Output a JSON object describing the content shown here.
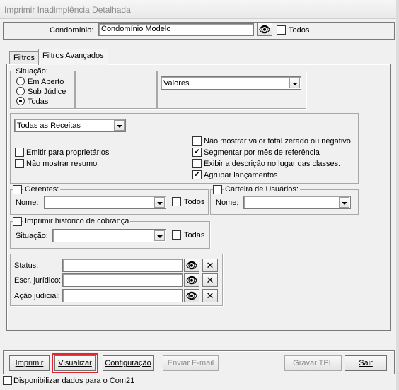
{
  "window": {
    "title": "Imprimir Inadimplência Detalhada"
  },
  "header": {
    "condominio_label": "Condomínio:",
    "condominio_value": "Condomínio Modelo",
    "todos_label": "Todos"
  },
  "tabs": [
    {
      "label": "Filtros"
    },
    {
      "label": "Filtros Avançados"
    }
  ],
  "situacao": {
    "title": "Situação:",
    "options": [
      "Em Aberto",
      "Sub Júdice",
      "Todas"
    ],
    "selected": "Todas"
  },
  "valores_select": "Valores",
  "receitas_select": "Todas as Receitas",
  "options_left": [
    {
      "label": "Emitir para proprietários",
      "checked": false
    },
    {
      "label": "Não mostrar resumo",
      "checked": false
    }
  ],
  "options_right": [
    {
      "label": "Não mostrar valor total zerado ou negativo",
      "checked": false
    },
    {
      "label": "Segmentar por mês de referência",
      "checked": true
    },
    {
      "label": "Exibir a descrição no lugar das classes.",
      "checked": false
    },
    {
      "label": "Agrupar lançamentos",
      "checked": true
    }
  ],
  "gerentes": {
    "title": "Gerentes:",
    "nome_label": "Nome:",
    "todos_label": "Todos"
  },
  "carteira": {
    "title": "Carteira de Usuários:",
    "nome_label": "Nome:"
  },
  "historico": {
    "title": "Imprimir histórico de cobrança",
    "situacao_label": "Situação:",
    "todas_label": "Todas"
  },
  "filters": [
    {
      "label": "Status:"
    },
    {
      "label": "Escr. jurídico:"
    },
    {
      "label": "Ação judicial:"
    }
  ],
  "buttons": {
    "imprimir": "Imprimir",
    "visualizar": "Visualizar",
    "configuracao": "Configuração",
    "enviar_email": "Enviar E-mail",
    "gravar_tpl": "Gravar TPL",
    "sair": "Sair"
  },
  "footer": {
    "com21_label": "Disponibilizar dados para o Com21"
  },
  "icons": {
    "search": "binoculars-icon",
    "clear": "x-icon"
  }
}
